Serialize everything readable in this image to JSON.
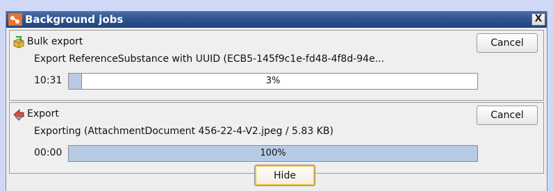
{
  "window": {
    "title": "Background jobs",
    "close_label": "X",
    "app_icon": "orange-app-icon"
  },
  "jobs": [
    {
      "name": "Bulk export",
      "icon": "package-export-icon",
      "description": "Export ReferenceSubstance with UUID (ECB5-145f9c1e-fd48-4f8d-94e...",
      "time": "10:31",
      "progress_percent": 3,
      "progress_text": "3%",
      "cancel_label": "Cancel"
    },
    {
      "name": "Export",
      "icon": "export-arrow-icon",
      "description": "Exporting (AttachmentDocument 456-22-4-V2.jpeg / 5.83 KB)",
      "time": "00:00",
      "progress_percent": 100,
      "progress_text": "100%",
      "cancel_label": "Cancel"
    }
  ],
  "hide_label": "Hide",
  "colors": {
    "titlebar": "#2e5590",
    "progress_fill": "#b7cbe4",
    "background": "#cfd8f6"
  }
}
